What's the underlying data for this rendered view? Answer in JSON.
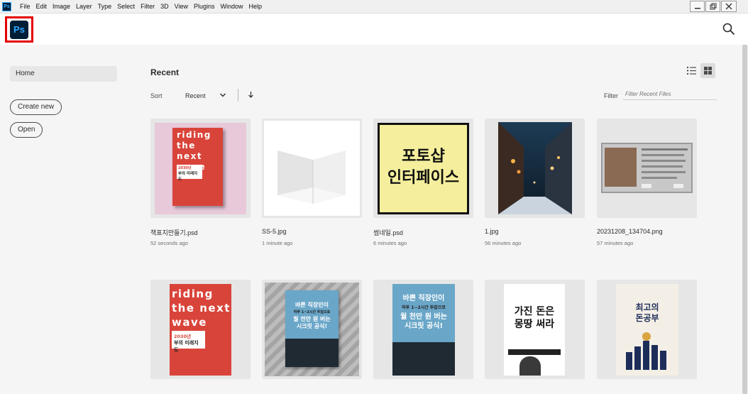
{
  "menubar": {
    "app_icon": "Ps",
    "items": [
      "File",
      "Edit",
      "Image",
      "Layer",
      "Type",
      "Select",
      "Filter",
      "3D",
      "View",
      "Plugins",
      "Window",
      "Help"
    ],
    "window_controls": [
      "minimize-icon",
      "restore-icon",
      "close-icon"
    ]
  },
  "header": {
    "logo_text": "Ps",
    "search_icon": "search-icon"
  },
  "sidebar": {
    "home_label": "Home",
    "create_new_label": "Create new",
    "open_label": "Open"
  },
  "main": {
    "title": "Recent",
    "sort_label": "Sort",
    "sort_value": "Recent",
    "filter_label": "Filter",
    "filter_placeholder": "Filter Recent Files",
    "view_modes": [
      "list-view-icon",
      "grid-view-icon"
    ],
    "active_view": "grid"
  },
  "files": [
    {
      "name": "책표지만들기.psd",
      "time": "52 seconds ago"
    },
    {
      "name": "SS-5.jpg",
      "time": "1 minute ago"
    },
    {
      "name": "썸네일.psd",
      "time": "6 minutes ago"
    },
    {
      "name": "1.jpg",
      "time": "56 minutes ago"
    },
    {
      "name": "20231208_134704.png",
      "time": "57 minutes ago"
    }
  ],
  "thumb_texts": {
    "riding_line1": "riding",
    "riding_line2": "the next",
    "riding_line3": "wave",
    "riding_year": "2030년",
    "riding_sub": "부의 미래지도",
    "thumb3_line1": "포토샵",
    "thumb3_line2": "인터페이스",
    "book_a_line1": "바쁜 직장인이",
    "book_a_line2": "하루 1~2시간 투잡으로",
    "book_a_line3": "월 천만 원 버는",
    "book_a_line4": "시크릿 공식!",
    "book_c_line1": "가진 돈은",
    "book_c_line2": "몽땅 써라",
    "book_d_line1": "최고의",
    "book_d_line2": "돈공부"
  },
  "colors": {
    "ps_blue": "#31a8ff",
    "ps_dark": "#001e36",
    "highlight_red": "#e30000",
    "book_red": "#d9443a"
  }
}
